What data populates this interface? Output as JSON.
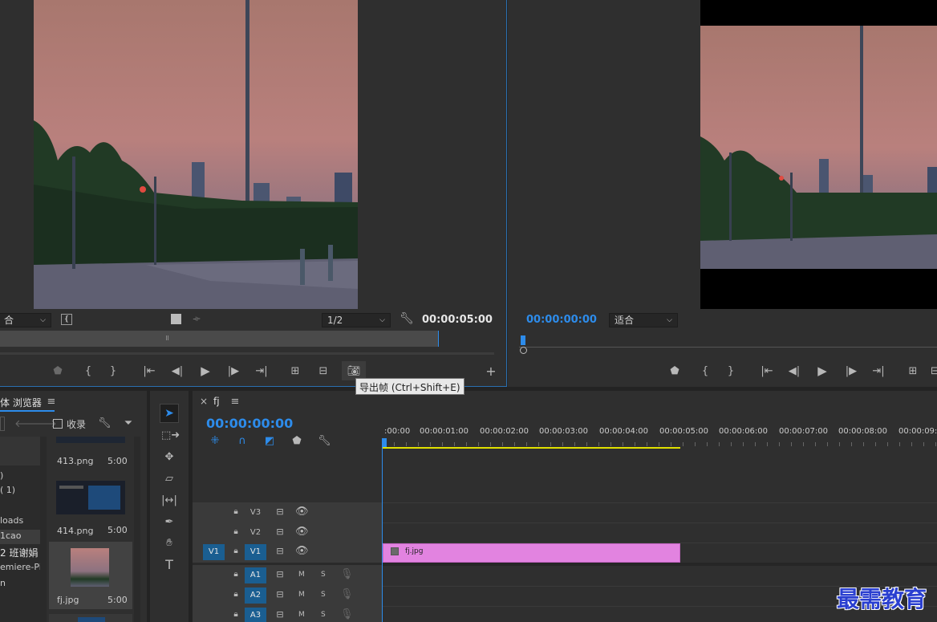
{
  "source_monitor": {
    "zoom_select": "合",
    "resolution_select": "1/2",
    "duration": "00:00:05:00",
    "controls": [
      "marker-icon",
      "mark-in-icon",
      "mark-out-icon",
      "go-to-in-icon",
      "step-back-icon",
      "play-icon",
      "step-forward-icon",
      "go-to-out-icon",
      "insert-icon",
      "overwrite-icon",
      "export-frame-icon",
      "add-button-icon"
    ]
  },
  "program_monitor": {
    "timecode": "00:00:00:00",
    "zoom_select": "适合"
  },
  "tooltip": "导出帧 (Ctrl+Shift+E)",
  "project_panel": {
    "tab_title": "体 浏览器",
    "favorite_label": "收录",
    "tree_items": [
      ")",
      "( 1)",
      "loads",
      "1cao",
      "2 班谢娟",
      "emiere-Pi",
      "n"
    ],
    "media": [
      {
        "name": "413.png",
        "duration": "5:00"
      },
      {
        "name": "414.png",
        "duration": "5:00"
      },
      {
        "name": "fj.jpg",
        "duration": "5:00"
      }
    ]
  },
  "timeline": {
    "close_label": "×",
    "sequence_name": "fj",
    "timecode": "00:00:00:00",
    "ruler": [
      ":00:00",
      "00:00:01:00",
      "00:00:02:00",
      "00:00:03:00",
      "00:00:04:00",
      "00:00:05:00",
      "00:00:06:00",
      "00:00:07:00",
      "00:00:08:00",
      "00:00:09:"
    ],
    "source_patch_v": "V1",
    "video_tracks": [
      "V3",
      "V2",
      "V1"
    ],
    "audio_tracks": [
      "A1",
      "A2",
      "A3"
    ],
    "mute_label": "M",
    "solo_label": "S",
    "clip": {
      "name": "fj.jpg",
      "color": "#e283e0"
    }
  },
  "watermark": "最需教育",
  "colors": {
    "accent": "#2d8ceb",
    "work_area": "#e0e000",
    "panel": "#2f2f2f"
  }
}
